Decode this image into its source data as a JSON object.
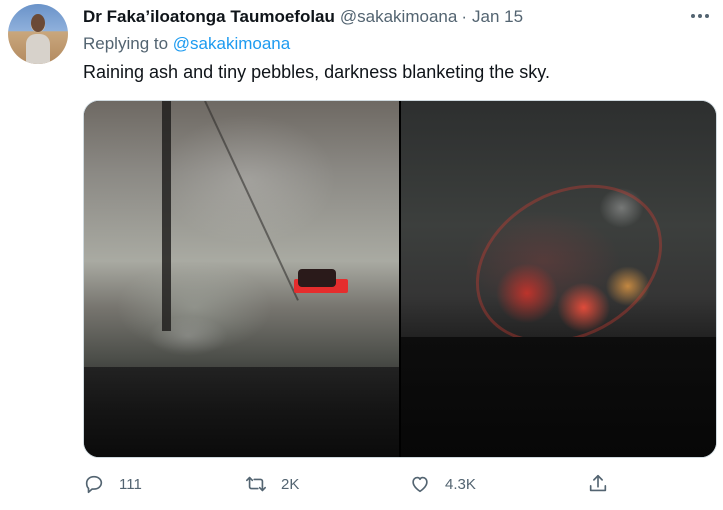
{
  "tweet": {
    "author_name": "Dr Faka’iloatonga Taumoefolau",
    "handle": "@sakakimoana",
    "dot": "·",
    "date": "Jan 15",
    "replying_prefix": "Replying to",
    "replying_to": "@sakakimoana",
    "text": "Raining ash and tiny pebbles, darkness blanketing the sky."
  },
  "actions": {
    "reply_count": "111",
    "retweet_count": "2K",
    "like_count": "4.3K"
  },
  "icons": {
    "more": "more-options-icon",
    "reply": "reply-icon",
    "retweet": "retweet-icon",
    "like": "heart-icon",
    "share": "share-icon"
  },
  "colors": {
    "text": "#0f1419",
    "secondary": "#536471",
    "link": "#1d9bf0",
    "border": "#cfd9de"
  }
}
